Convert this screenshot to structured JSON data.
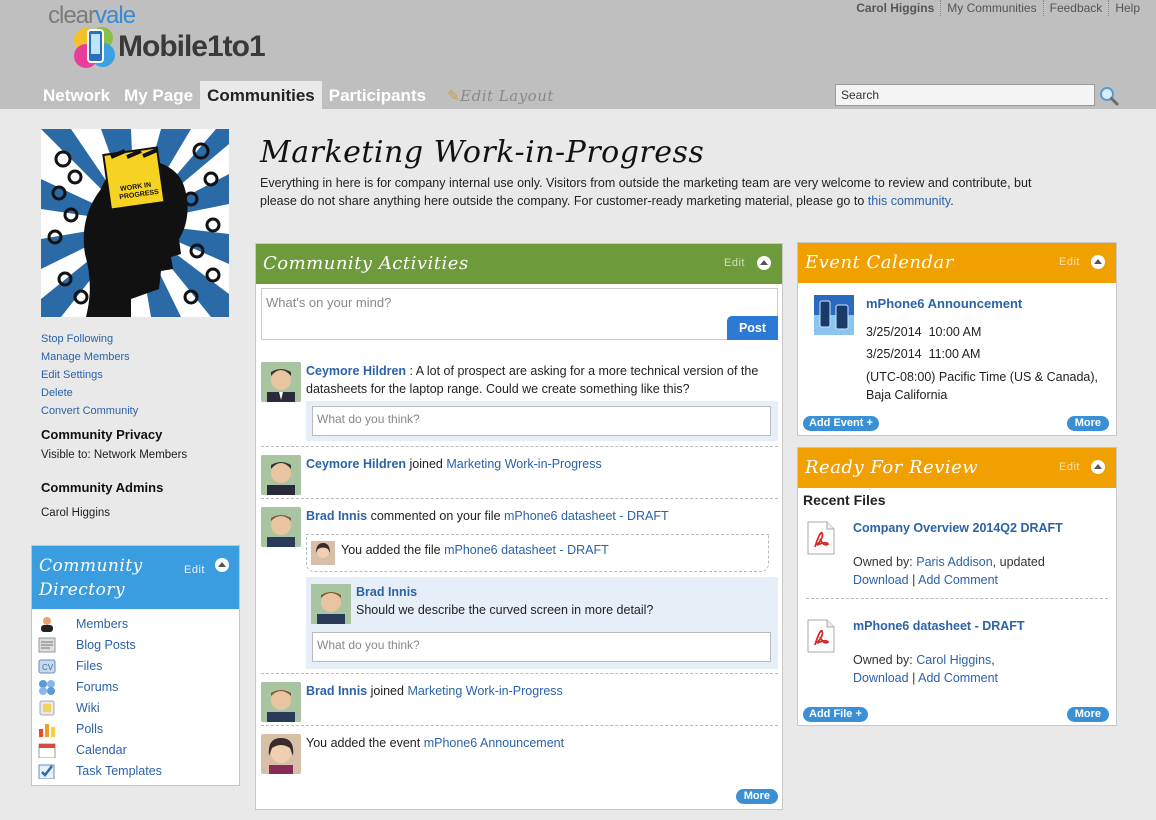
{
  "header": {
    "brand_top_a": "clear",
    "brand_top_b": "vale",
    "brand_name": "Mobile1to1",
    "top_links": [
      "Carol Higgins",
      "My Communities",
      "Feedback",
      "Help"
    ],
    "nav": [
      "Network",
      "My Page",
      "Communities",
      "Participants"
    ],
    "edit_layout": "Edit Layout",
    "search_value": "Search"
  },
  "sidebar": {
    "actions": [
      "Stop Following",
      "Manage Members",
      "Edit Settings",
      "Delete",
      "Convert Community"
    ],
    "privacy_title": "Community Privacy",
    "privacy_text": "Visible to: Network Members",
    "admins_title": "Community Admins",
    "admin_name": "Carol Higgins",
    "directory": {
      "title_line1": "Community",
      "title_line2": "Directory",
      "edit": "Edit",
      "items": [
        "Members",
        "Blog Posts",
        "Files",
        "Forums",
        "Wiki",
        "Polls",
        "Calendar",
        "Task Templates"
      ]
    }
  },
  "main": {
    "title": "Marketing Work-in-Progress",
    "desc_text": "Everything in here is for company internal use only. Visitors from outside the marketing team are very welcome to review and contribute, but please do not share anything here outside the company. For customer-ready marketing material, please go to",
    "desc_link": "this community",
    "desc_end": "."
  },
  "activities": {
    "title": "Community Activities",
    "edit": "Edit",
    "status_placeholder": "What's on your mind?",
    "post": "Post",
    "comment_placeholder": "What do you think?",
    "items": [
      {
        "user": "Ceymore Hildren",
        "text": " : A lot of prospect are asking for a more technical version of the datasheets for the laptop range. Could we create something like this?"
      },
      {
        "user": "Ceymore Hildren",
        "text": " joined ",
        "link": "Marketing Work-in-Progress"
      },
      {
        "user": "Brad Innis",
        "text": " commented on your file ",
        "link": "mPhone6 datasheet - DRAFT",
        "sub_text": "You added the file ",
        "sub_link": "mPhone6 datasheet - DRAFT",
        "reply_user": "Brad Innis",
        "reply_text": "Should we describe the curved screen in more detail?"
      },
      {
        "user": "Brad Innis",
        "text": " joined ",
        "link": "Marketing Work-in-Progress"
      },
      {
        "text": "You added the event ",
        "link": "mPhone6 Announcement"
      }
    ],
    "more": "More"
  },
  "calendar": {
    "title": "Event Calendar",
    "edit": "Edit",
    "event_title": "mPhone6 Announcement",
    "start_date": "3/25/2014",
    "start_time": "10:00 AM",
    "end_date": "3/25/2014",
    "end_time": "11:00 AM",
    "timezone": "(UTC-08:00) Pacific Time (US & Canada), Baja California",
    "add": "Add Event +",
    "more": "More"
  },
  "review": {
    "title": "Ready For Review",
    "edit": "Edit",
    "subtitle": "Recent Files",
    "files": [
      {
        "title": "Company Overview 2014Q2 DRAFT",
        "owned_label": "Owned by: ",
        "owner": "Paris Addison",
        "suffix": ", updated",
        "download": "Download",
        "comment": "Add Comment"
      },
      {
        "title": "mPhone6 datasheet - DRAFT",
        "owned_label": "Owned by: ",
        "owner": "Carol Higgins",
        "suffix": ",",
        "download": "Download",
        "comment": "Add Comment"
      }
    ],
    "add": "Add File +",
    "more": "More"
  },
  "colors": {
    "activities_header": "#6d9a3a",
    "calendar_header": "#f0a000",
    "directory_header": "#3a9de0",
    "link": "#2b62a8",
    "button": "#2d7ad6"
  }
}
